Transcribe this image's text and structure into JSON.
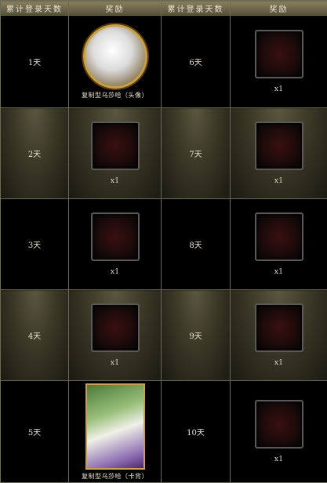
{
  "headers": {
    "days_left": "累计登录天数",
    "reward_left": "奖励",
    "days_right": "累计登录天数",
    "reward_right": "奖励"
  },
  "rows": [
    {
      "left_day": "1天",
      "left_caption": "复制型乌莎哈（头像）",
      "right_day": "6天",
      "right_qty": "x1"
    },
    {
      "left_day": "2天",
      "left_qty": "x1",
      "right_day": "7天",
      "right_qty": "x1"
    },
    {
      "left_day": "3天",
      "left_qty": "x1",
      "right_day": "8天",
      "right_qty": "x1"
    },
    {
      "left_day": "4天",
      "left_qty": "x1",
      "right_day": "9天",
      "right_qty": "x1"
    },
    {
      "left_day": "5天",
      "left_caption": "复制型乌莎哈（卡背）",
      "right_day": "10天",
      "right_qty": "x1"
    }
  ],
  "icons": {
    "item": "crest-emblem-icon",
    "avatar": "avatar-portrait-icon",
    "card_back": "card-back-icon"
  },
  "colors": {
    "border": "#6b6a55",
    "header_bg": "#6e664a",
    "text": "#e8e4d0"
  }
}
